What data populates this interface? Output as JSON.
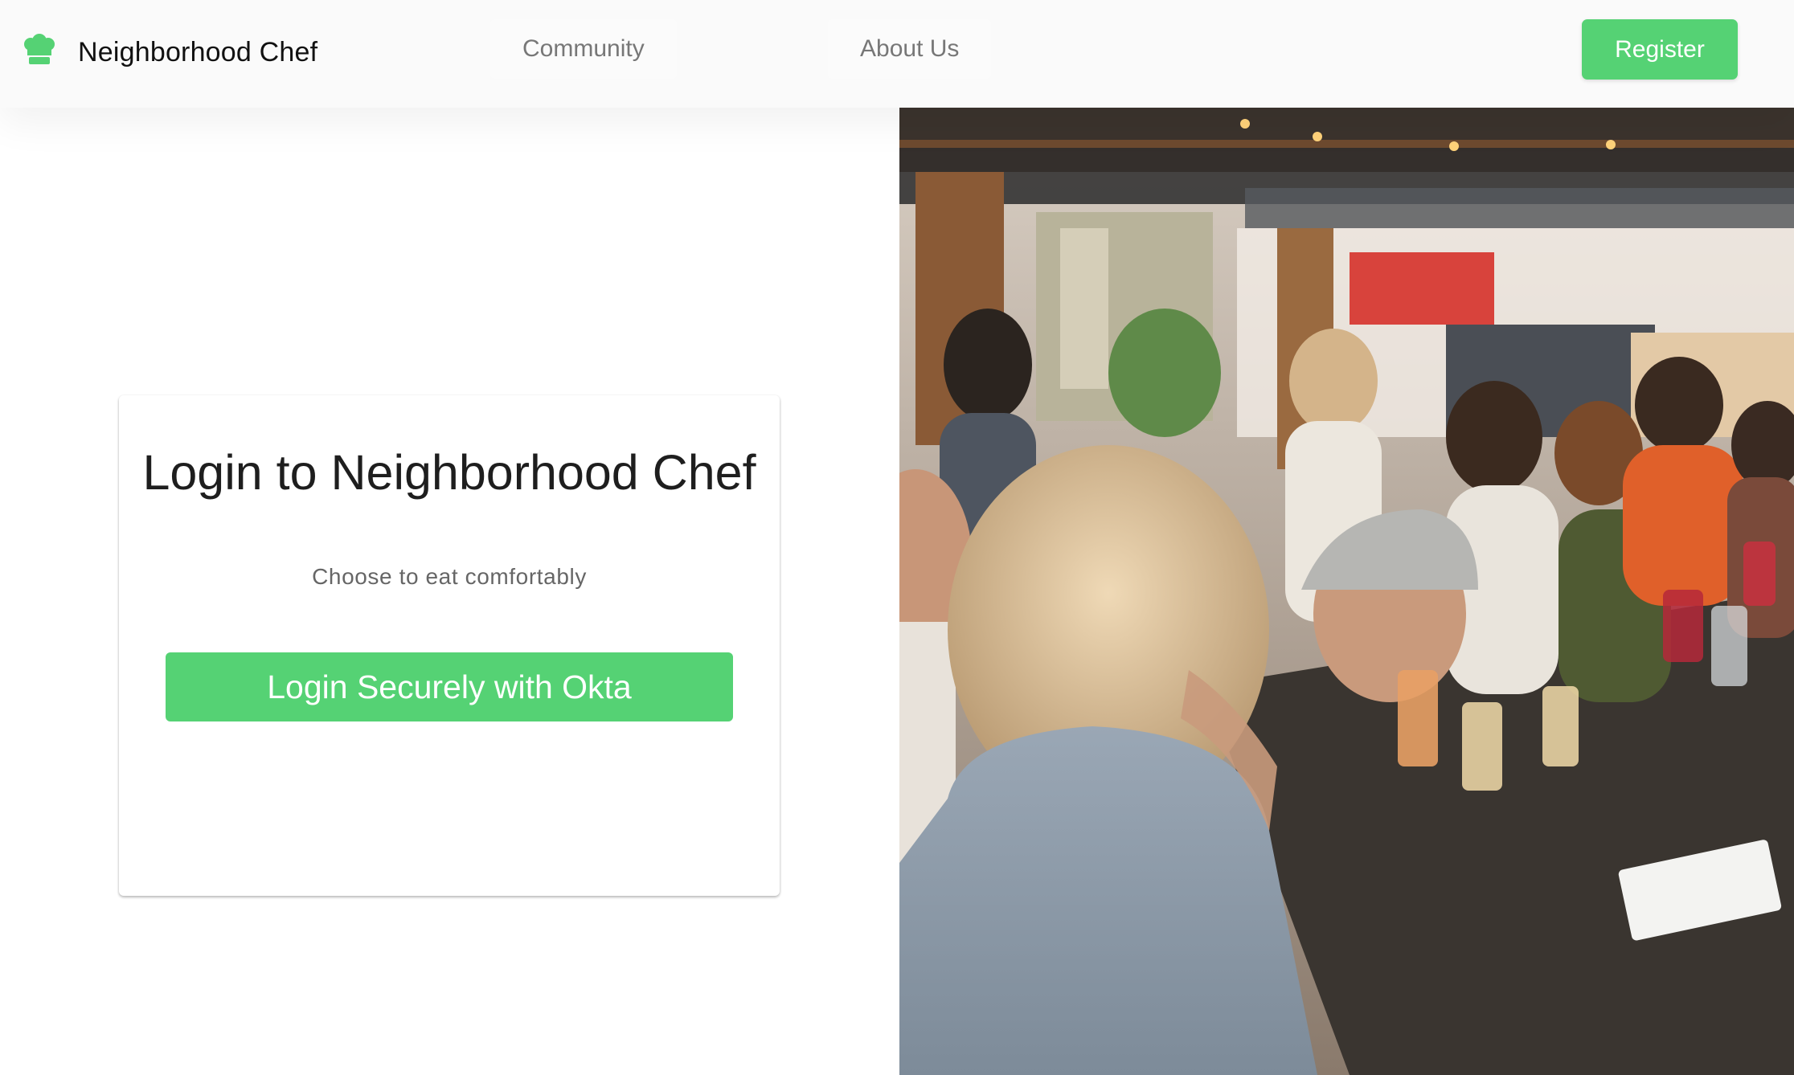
{
  "header": {
    "brand": "Neighborhood Chef",
    "logo_icon": "chef-hat-icon",
    "nav": [
      {
        "label": "Community"
      },
      {
        "label": "About Us"
      }
    ],
    "register_label": "Register"
  },
  "login": {
    "title": "Login to Neighborhood Chef",
    "subtitle": "Choose to eat comfortably",
    "okta_button_label": "Login Securely with Okta"
  },
  "hero_image": {
    "subject": "people-dining-at-outdoor-table"
  },
  "colors": {
    "accent": "#55d274",
    "header_bg": "#fafafa",
    "text_dark": "#1e1e1e",
    "text_muted": "#777777"
  }
}
